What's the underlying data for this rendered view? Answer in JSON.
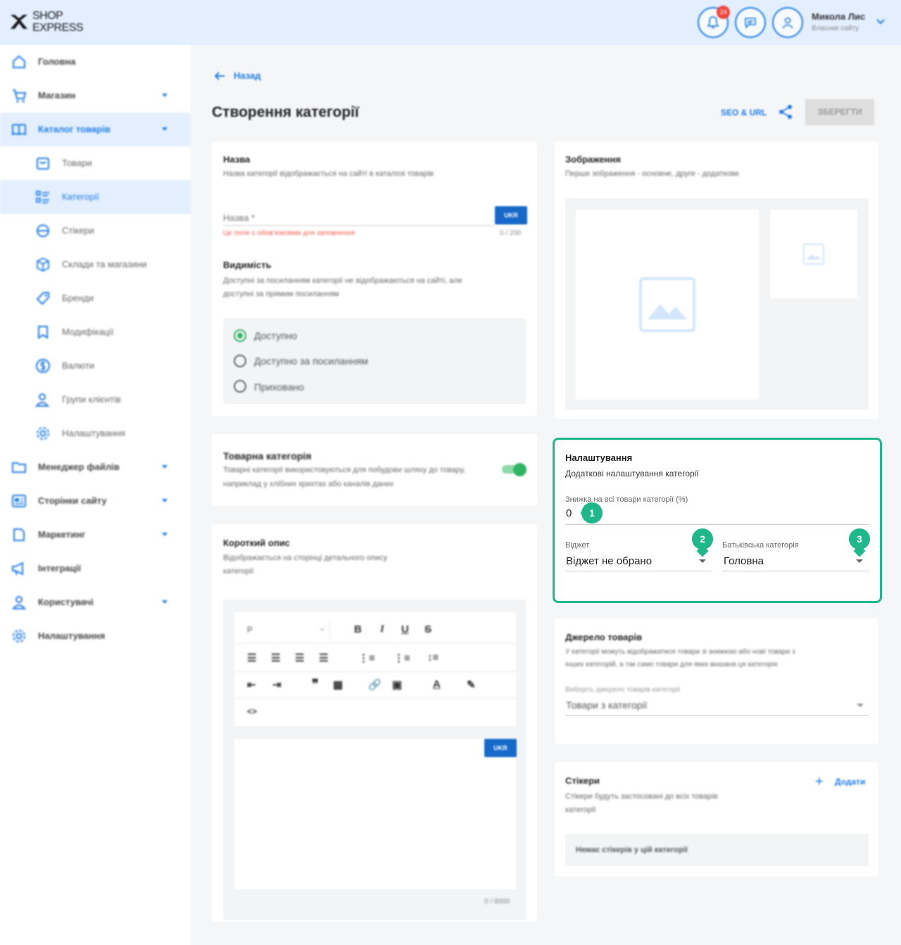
{
  "header": {
    "logo_line1": "SHOP",
    "logo_line2": "EXPRESS",
    "notifications_count": "24",
    "user_name": "Микола Лис",
    "user_role": "Власник сайту"
  },
  "sidebar": {
    "items": [
      {
        "label": "Головна",
        "icon": "home-icon"
      },
      {
        "label": "Магазин",
        "icon": "cart-icon"
      },
      {
        "label": "Каталог товарів",
        "icon": "book-icon"
      },
      {
        "label": "Товари",
        "icon": "box-icon"
      },
      {
        "label": "Категорії",
        "icon": "list-icon"
      },
      {
        "label": "Стікери",
        "icon": "sticker-icon"
      },
      {
        "label": "Склади та магазини",
        "icon": "warehouse-icon"
      },
      {
        "label": "Бренди",
        "icon": "tag-icon"
      },
      {
        "label": "Модифікації",
        "icon": "bookmark-icon"
      },
      {
        "label": "Валюти",
        "icon": "currency-icon"
      },
      {
        "label": "Групи клієнтів",
        "icon": "users-icon"
      },
      {
        "label": "Налаштування",
        "icon": "gear-icon"
      },
      {
        "label": "Менеджер файлів",
        "icon": "folder-icon"
      },
      {
        "label": "Сторінки сайту",
        "icon": "pages-icon"
      },
      {
        "label": "Маркетинг",
        "icon": "marketing-icon"
      },
      {
        "label": "Інтеграції",
        "icon": "megaphone-icon"
      },
      {
        "label": "Користувачі",
        "icon": "user-icon"
      },
      {
        "label": "Налаштування",
        "icon": "gear-icon"
      }
    ]
  },
  "page": {
    "back_label": "Назад",
    "title": "Створення категорії",
    "seo_label": "SEO & URL",
    "save_label": "ЗБЕРЕГТИ"
  },
  "name_card": {
    "title": "Назва",
    "desc": "Назва категорії відображається на сайті в каталозі товарів",
    "placeholder": "Назва *",
    "lang": "UKR",
    "error": "Це поле є обов'язковим для заповнення",
    "counter": "0 / 200",
    "visibility_title": "Видимість",
    "visibility_desc_1": "Доступні за посиланням категорії не відображаються на сайті, але",
    "visibility_desc_2": "доступні за прямим посиланням",
    "options": [
      "Доступно",
      "Доступно за посиланням",
      "Приховано"
    ]
  },
  "product_category_card": {
    "title": "Товарна категорія",
    "desc_1": "Товарні категорії використовуються для побудови шляху до товару,",
    "desc_2": "наприклад у хлібних крихтах або каналів даних",
    "enabled": true
  },
  "short_desc_card": {
    "title": "Короткий опис",
    "desc_1": "Відображається на сторінці детального опису",
    "desc_2": "категорії",
    "format_value": "P",
    "lang": "UKR",
    "counter": "0 / 8000"
  },
  "images_card": {
    "title": "Зображення",
    "desc": "Перше зображення - основне, друге - додаткове"
  },
  "settings_card": {
    "title": "Налаштування",
    "desc": "Додаткові налаштування категорії",
    "discount_label": "Знижка на всі товари категорії (%)",
    "discount_value": "0",
    "widget_label": "Віджет",
    "widget_value": "Віджет не обрано",
    "parent_label": "Батьківська категорія",
    "parent_value": "Головна",
    "markers": [
      "1",
      "2",
      "3"
    ],
    "accent": "#1fb88a"
  },
  "source_card": {
    "title": "Джерело товарів",
    "desc_1": "У категорії можуть відображатися товари зі знижкою або нові товари з",
    "desc_2": "інших категорій, а так само товари для яких вказана ця категорія",
    "select_label": "Виберіть джерело товарів категорії",
    "select_value": "Товари з категорії"
  },
  "stickers_card": {
    "title": "Стікери",
    "desc_1": "Стікери будуть застосовані до всіх товарів",
    "desc_2": "категорії",
    "add_label": "Додати",
    "empty": "Немає стікерів у цій категорії"
  }
}
